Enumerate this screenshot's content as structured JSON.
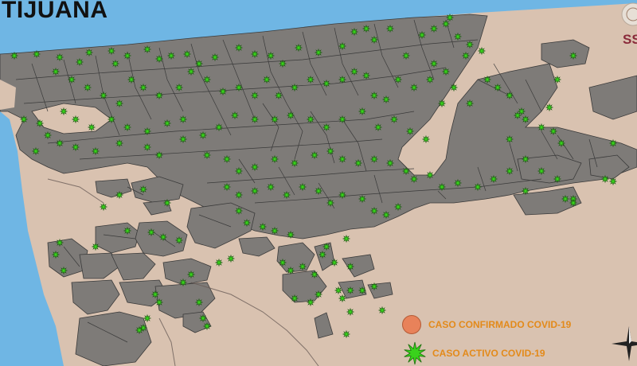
{
  "map_title": "TIJUANA",
  "agency_logo_text": "SS",
  "legend": {
    "confirmed_label": "CASO CONFIRMADO COVID-19",
    "active_label": "CASO ACTIVO COVID-19"
  },
  "colors": {
    "ocean": "#6fb6e4",
    "land": "#d9c2b0",
    "urban_block": "#7e7b78",
    "block_border": "#3a3a3a",
    "active_case": "#39d21c",
    "confirmed_case": "#e8825a",
    "legend_text": "#e38a1a"
  },
  "icons": [
    "active-case-star-icon",
    "confirmed-case-circle-icon",
    "north-arrow-icon",
    "agency-seal-icon"
  ]
}
